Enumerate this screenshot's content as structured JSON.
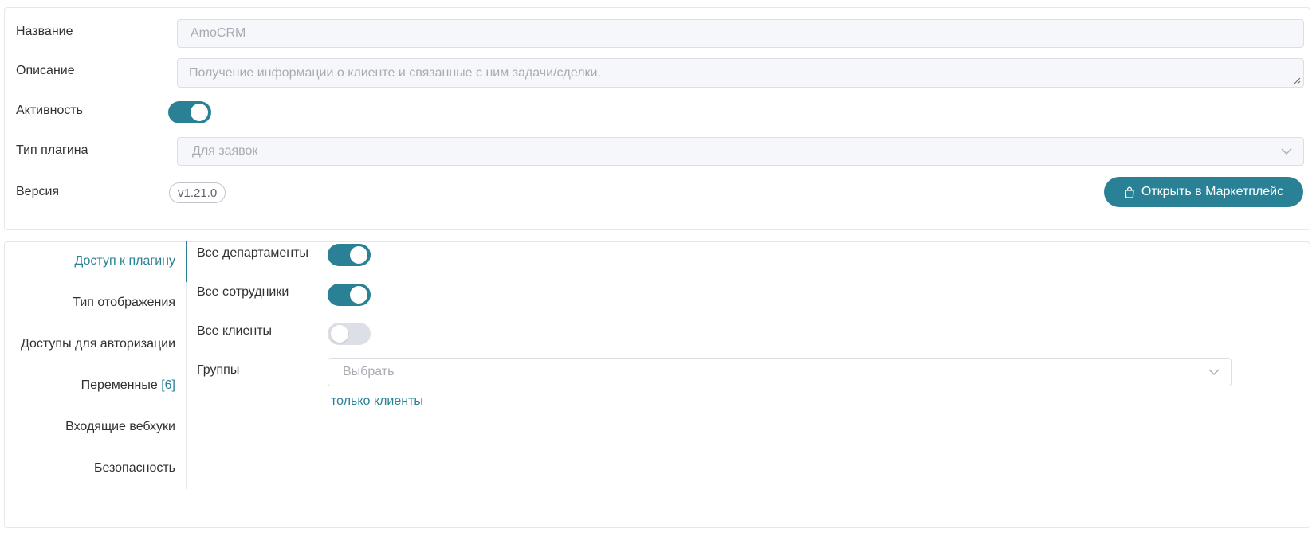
{
  "general": {
    "name_label": "Название",
    "name_value": "AmoCRM",
    "description_label": "Описание",
    "description_value": "Получение информации о клиенте и связанные с ним задачи/сделки.",
    "active_label": "Активность",
    "active": true,
    "plugin_type_label": "Тип плагина",
    "plugin_type_value": "Для заявок",
    "version_label": "Версия",
    "version_value": "v1.21.0",
    "marketplace_button": "Открыть в Маркетплейс",
    "marketplace_icon": "shopping-bag-icon"
  },
  "tabs": [
    {
      "label": "Доступ к плагину",
      "active": true
    },
    {
      "label": "Тип отображения"
    },
    {
      "label": "Доступы для авторизации"
    },
    {
      "label": "Переменные",
      "count": "[6]"
    },
    {
      "label": "Входящие вебхуки"
    },
    {
      "label": "Безопасность"
    }
  ],
  "access": {
    "all_departments_label": "Все департаменты",
    "all_departments": true,
    "all_employees_label": "Все сотрудники",
    "all_employees": true,
    "all_clients_label": "Все клиенты",
    "all_clients": false,
    "groups_label": "Группы",
    "groups_placeholder": "Выбрать",
    "clients_only_link": "только клиенты"
  },
  "colors": {
    "accent": "#2a8196",
    "border": "#dcdfe6",
    "placeholder": "#a8abb2"
  }
}
